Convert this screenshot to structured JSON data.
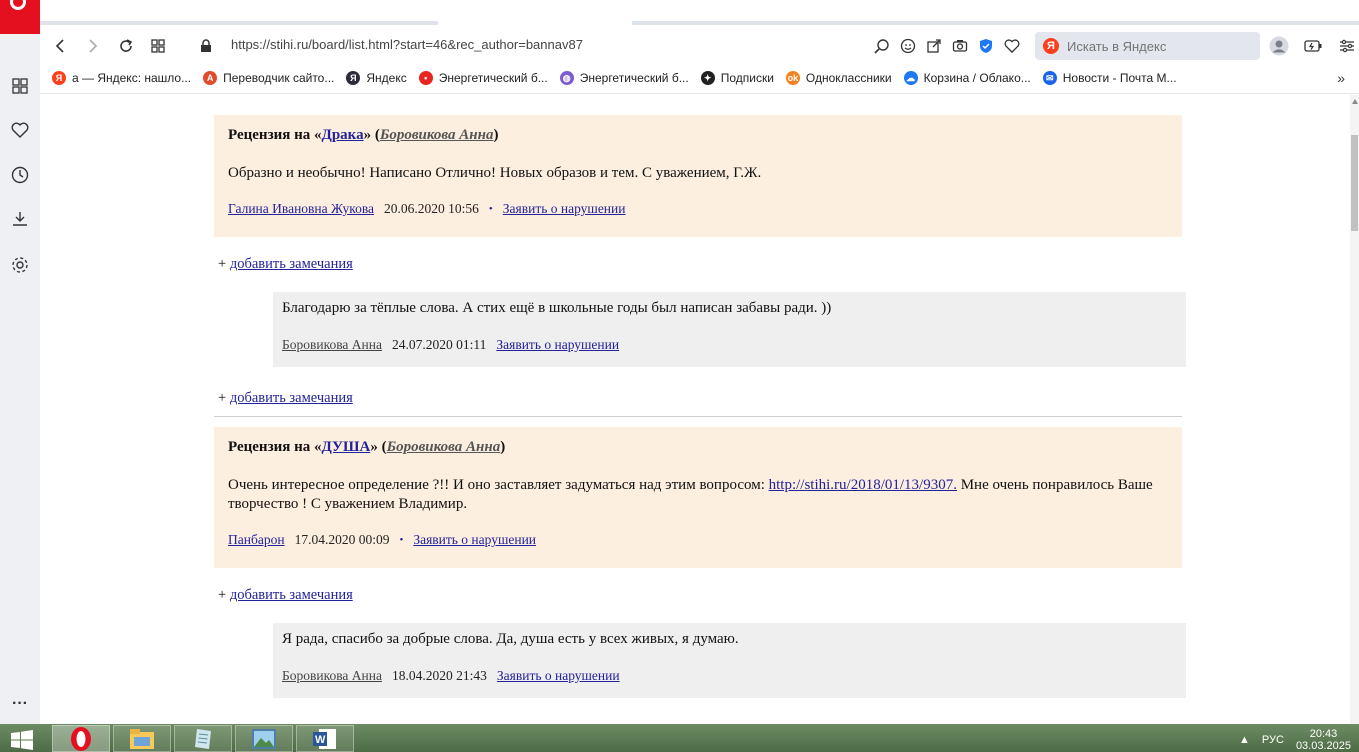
{
  "browser": {
    "url": "https://stihi.ru/board/list.html?start=46&rec_author=bannav87",
    "search_placeholder": "Искать в Яндекс",
    "bookmarks": [
      {
        "label": "а — Яндекс: нашло...",
        "icon": "yandex-icon",
        "color": "#fc3f1d"
      },
      {
        "label": "Переводчик сайто...",
        "icon": "translator-icon",
        "color": "#e24a2b"
      },
      {
        "label": "Яндекс",
        "icon": "yandex-browser-icon",
        "color": "#2b2b3b"
      },
      {
        "label": "Энергетический б...",
        "icon": "map-pin-icon",
        "color": "#e5271f"
      },
      {
        "label": "Энергетический б...",
        "icon": "globe-icon",
        "color": "#7c5ccf"
      },
      {
        "label": "Подписки",
        "icon": "sparkle-icon",
        "color": "#222222"
      },
      {
        "label": "Одноклассники",
        "icon": "ok-icon",
        "color": "#f58220"
      },
      {
        "label": "Корзина / Облако...",
        "icon": "cloud-icon",
        "color": "#1e78f0"
      },
      {
        "label": "Новости - Почта М...",
        "icon": "mail-icon",
        "color": "#1a63e8"
      }
    ]
  },
  "reviews": [
    {
      "prefix": "Рецензия на «",
      "work": "Драка",
      "mid": "» (",
      "author": "Боровикова Анна",
      "suffix": ")",
      "text": "Образно и необычно! Написано Отлично! Новых образов и тем. С уважением, Г.Ж.",
      "reviewer": "Галина Ивановна Жукова",
      "date": "20.06.2020 10:56",
      "report": "Заявить о нарушении",
      "add_note": "добавить замечания",
      "reply": {
        "text": "Благодарю за тёплые слова. А стих ещё в школьные годы был написан забавы ради. ))",
        "author": "Боровикова Анна",
        "date": "24.07.2020 01:11",
        "report": "Заявить о нарушении",
        "add_note": "добавить замечания"
      }
    },
    {
      "prefix": "Рецензия на «",
      "work": "ДУША",
      "mid": "» (",
      "author": "Боровикова Анна",
      "suffix": ")",
      "text_before": "Очень интересное определение ?!! И оно заставляет задуматься над этим вопросом: ",
      "link": "http://stihi.ru/2018/01/13/9307.",
      "text_after": " Мне очень понравилось Ваше творчество ! С уважением Владимир.",
      "reviewer": "Панбарон",
      "date": "17.04.2020 00:09",
      "report": "Заявить о нарушении",
      "add_note": "добавить замечания",
      "reply": {
        "text": "Я рада, спасибо за добрые слова. Да, душа есть у всех живых, я думаю.",
        "author": "Боровикова Анна",
        "date": "18.04.2020 21:43",
        "report": "Заявить о нарушении"
      }
    }
  ],
  "taskbar": {
    "lang": "РУС",
    "time": "20:43",
    "date": "03.03.2025"
  }
}
